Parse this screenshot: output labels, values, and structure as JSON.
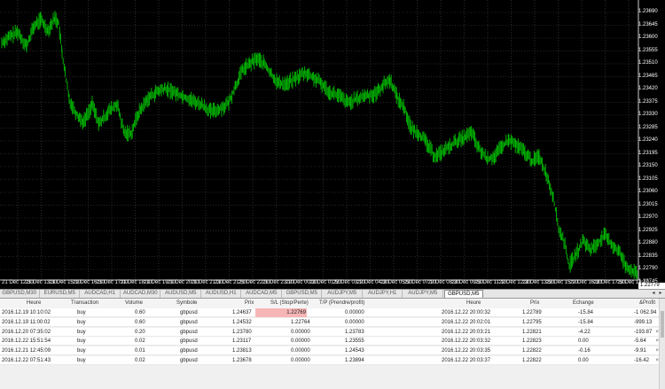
{
  "chart": {
    "symbol": "GBPUSD",
    "timeframe": "M5",
    "bg_color": "#000000",
    "bar_color": "#00c000",
    "grid_color": "#4a4a4a",
    "price_labels": [
      "1.23690",
      "1.23645",
      "1.23600",
      "1.23555",
      "1.23510",
      "1.23465",
      "1.23420",
      "1.23375",
      "1.23330",
      "1.23285",
      "1.23240",
      "1.23195",
      "1.23150",
      "1.23105",
      "1.23060",
      "1.23015",
      "1.22970",
      "1.22925",
      "1.22880",
      "1.22835",
      "1.22790",
      "1.22745"
    ],
    "current_price": "1.22779",
    "time_labels": [
      "21 Dec 12:30",
      "21 Dec 13:30",
      "21 Dec 15:10",
      "21 Dec 16:30",
      "21 Dec 17:00",
      "21 Dec 18:10",
      "21 Dec 19:10",
      "21 Dec 20:10",
      "21 Dec 21:30",
      "21 Dec 21:50",
      "21 Dec 22:30",
      "21 Dec 23:10",
      "22 Dec 00:30",
      "22 Dec 01:50",
      "22 Dec 03:10",
      "22 Dec 04:30",
      "22 Dec 05:50",
      "22 Dec 07:10",
      "22 Dec 08:30",
      "22 Dec 09:50",
      "22 Dec 11:10",
      "22 Dec 12:30",
      "22 Dec 13:50",
      "22 Dec 15:10",
      "22 Dec 16:30",
      "22 Dec 17:50",
      "22 Dec 19:10"
    ]
  },
  "tabs": [
    "GBPUSD,M30",
    "EURUSD,M5",
    "AUDCAD,H1",
    "AUDCAD,M30",
    "AUDUSD,M5",
    "AUDUSD,H1",
    "AUDCAD,M5",
    "GBPUSD,M5",
    "AUDJPY,M5",
    "AUDJPY,H1",
    "AUDJPY,M5",
    "GBPUSD,M5"
  ],
  "active_tab_index": 11,
  "terminal": {
    "headers": {
      "heure": "Heure",
      "transaction": "Transaction",
      "volume": "Volume",
      "symbole": "Symbole",
      "prix": "Prix",
      "sl": "S/L (Stop/Perte)",
      "tp": "T/P (Prendre/profit)",
      "heure_close": "Heure",
      "prix_close": "Prix",
      "echange": "Echange",
      "profit": "&Profit"
    },
    "rows": [
      {
        "time": "2016.12.19 10:10:02",
        "type": "buy",
        "volume": "0.60",
        "symbol": "gbpusd",
        "price": "1.24637",
        "sl": "1.22769",
        "tp": "0.00000",
        "close_time": "2016.12.22 20:00:32",
        "close_price": "1.22789",
        "swap": "-15.84",
        "profit": "-1 062.94",
        "sl_highlight": true
      },
      {
        "time": "2016.12.19 11:00:02",
        "type": "buy",
        "volume": "0.60",
        "symbol": "gbpusd",
        "price": "1.24532",
        "sl": "1.22764",
        "tp": "0.00000",
        "close_time": "2016.12.22 20:02:01",
        "close_price": "1.22795",
        "swap": "-15.84",
        "profit": "-999.13",
        "sl_highlight": false
      },
      {
        "time": "2016.12.20 07:35:02",
        "type": "buy",
        "volume": "0.20",
        "symbol": "gbpusd",
        "price": "1.23780",
        "sl": "0.00000",
        "tp": "1.23783",
        "close_time": "2016.12.22 20:03:21",
        "close_price": "1.22821",
        "swap": "-4.22",
        "profit": "-193.87",
        "sl_highlight": false
      },
      {
        "time": "2016.12.22 15:51:54",
        "type": "buy",
        "volume": "0.02",
        "symbol": "gbpusd",
        "price": "1.23117",
        "sl": "0.00000",
        "tp": "1.23555",
        "close_time": "2016.12.22 20:03:32",
        "close_price": "1.22823",
        "swap": "0.00",
        "profit": "-5.64",
        "sl_highlight": false
      },
      {
        "time": "2016.12.21 12:45:09",
        "type": "buy",
        "volume": "0.01",
        "symbol": "gbpusd",
        "price": "1.23813",
        "sl": "0.00000",
        "tp": "1.24543",
        "close_time": "2016.12.22 20:03:35",
        "close_price": "1.22822",
        "swap": "-0.16",
        "profit": "-9.91",
        "sl_highlight": false
      },
      {
        "time": "2016.12.22 07:51:43",
        "type": "buy",
        "volume": "0.02",
        "symbol": "gbpusd",
        "price": "1.23678",
        "sl": "0.00000",
        "tp": "1.23894",
        "close_time": "2016.12.22 20:03:37",
        "close_price": "1.22822",
        "swap": "0.00",
        "profit": "-16.42",
        "sl_highlight": false
      }
    ]
  }
}
